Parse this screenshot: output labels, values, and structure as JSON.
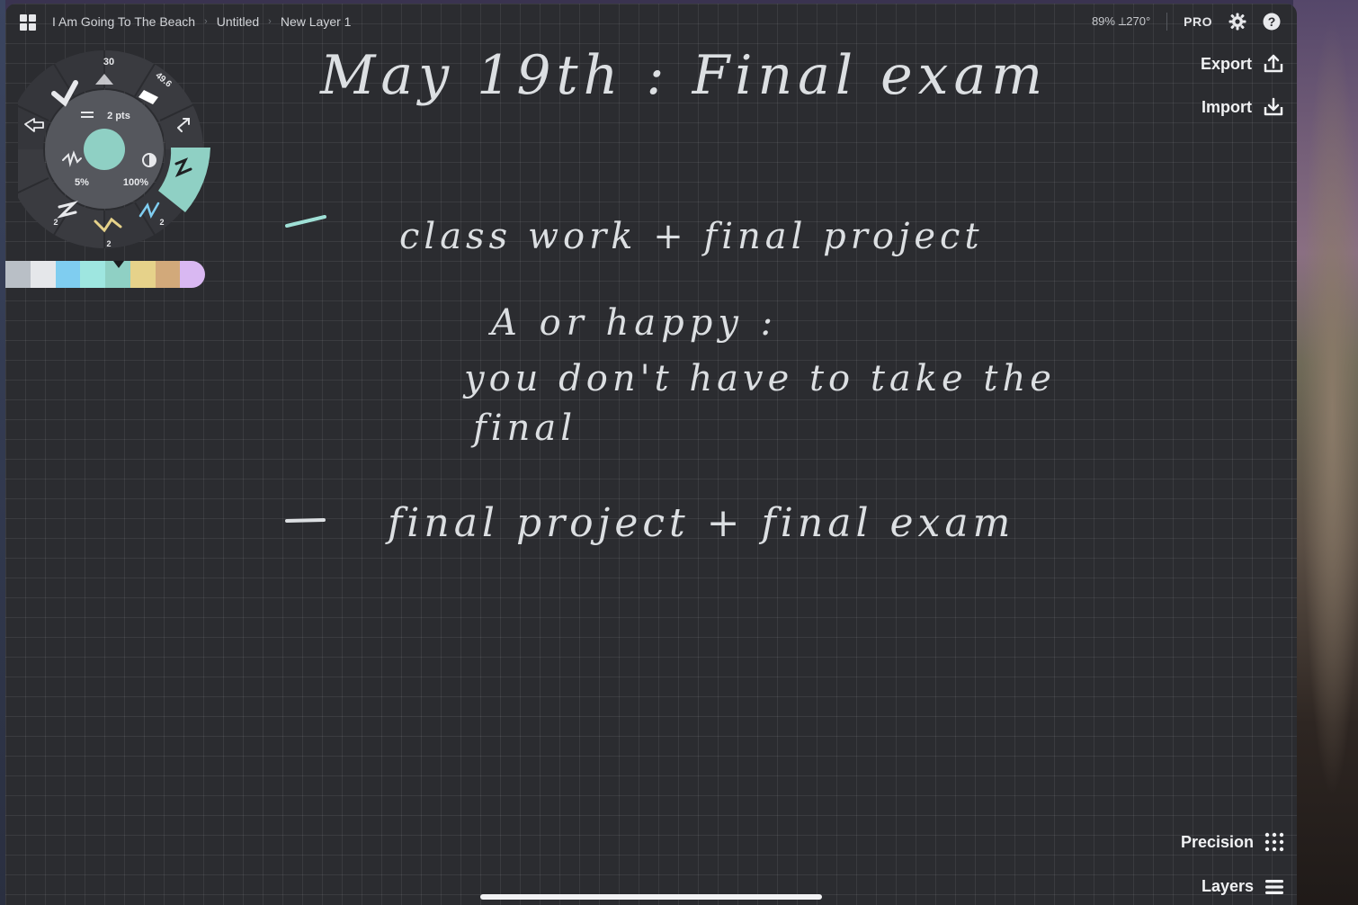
{
  "topbar": {
    "breadcrumb": [
      "I Am Going To The Beach",
      "Untitled",
      "New Layer 1"
    ],
    "zoom_rotation": "89% ⟂270°",
    "pro_label": "PRO",
    "icons": [
      "apps-grid-icon",
      "gear-icon",
      "help-icon"
    ]
  },
  "side_actions": {
    "export_label": "Export",
    "import_label": "Import"
  },
  "bottom_actions": {
    "precision_label": "Precision",
    "layers_label": "Layers"
  },
  "tool_wheel": {
    "size_top": "30",
    "size_top_right": "49.6",
    "stroke_width": "2 pts",
    "smoothing": "5%",
    "opacity": "100%",
    "bottom_left": "2",
    "bottom": "2",
    "bottom_right": "2",
    "active_color": "#8fd0c4",
    "active_tool": "pen"
  },
  "color_palette": [
    "#b9bfc6",
    "#e5e7ea",
    "#7fcdf0",
    "#9ee6e0",
    "#8fd0c4",
    "#e6d28a",
    "#d2a97a",
    "#d9b8f2"
  ],
  "handwriting": {
    "title": "May 19th : Final exam",
    "line1": "class work + final project",
    "line2": "A or happy :",
    "line3": "you don't have to take the",
    "line4": "final",
    "line5": "final project + final exam",
    "ink_color": "#dcdfe2",
    "bullet_color": "#9fe0d6"
  }
}
